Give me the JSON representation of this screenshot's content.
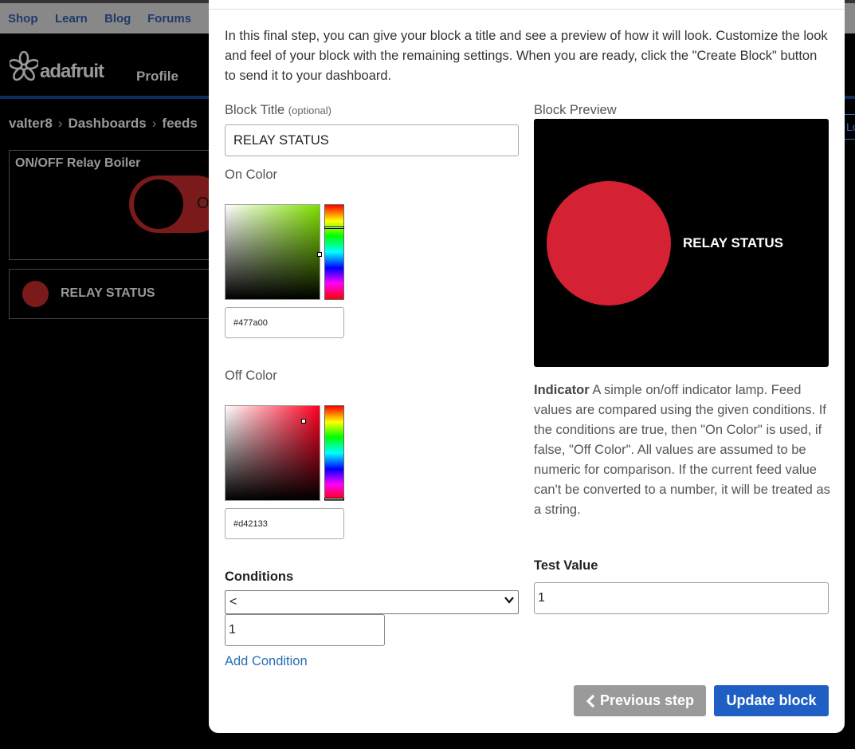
{
  "topnav": {
    "items": [
      "Shop",
      "Learn",
      "Blog",
      "Forums"
    ]
  },
  "header": {
    "logo_text": "adafruit",
    "profile": "Profile"
  },
  "breadcrumb": {
    "items": [
      "valter8",
      "Dashboards",
      "feeds"
    ],
    "right_stub": "Lo"
  },
  "dashboard": {
    "toggle_block": {
      "title": "ON/OFF Relay Boiler",
      "state_glyph": "O"
    },
    "indicator_block": {
      "label": "RELAY STATUS"
    }
  },
  "modal": {
    "intro": "In this final step, you can give your block a title and see a preview of how it will look. Customize the look and feel of your block with the remaining settings. When you are ready, click the \"Create Block\" button to send it to your dashboard.",
    "block_title_label": "Block Title",
    "block_title_optional": "(optional)",
    "block_title_value": "RELAY STATUS",
    "on_color_label": "On Color",
    "on_color_value": "#477a00",
    "on_color_hue": "#80e000",
    "off_color_label": "Off Color",
    "off_color_value": "#d42133",
    "off_color_hue": "#ff0020",
    "preview_label": "Block Preview",
    "preview_text": "RELAY STATUS",
    "preview_lamp_color": "#d42133",
    "description_title": "Indicator",
    "description": "A simple on/off indicator lamp. Feed values are compared using the given conditions. If the conditions are true, then \"On Color\" is used, if false, \"Off Color\". All values are assumed to be numeric for comparison. If the current feed value can't be converted to a number, it will be treated as a string.",
    "conditions_label": "Conditions",
    "condition_operator": "<",
    "condition_value": "1",
    "add_condition": "Add Condition",
    "test_value_label": "Test Value",
    "test_value": "1",
    "prev_button": "Previous step",
    "update_button": "Update block"
  }
}
